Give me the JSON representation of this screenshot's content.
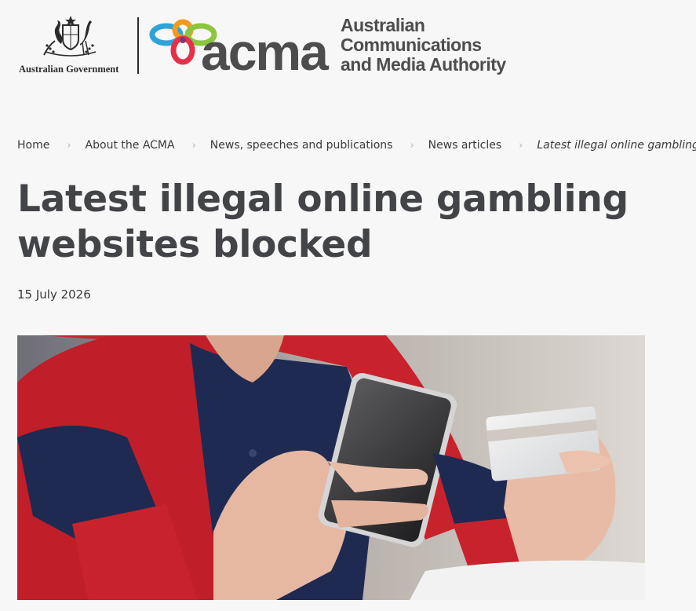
{
  "header": {
    "gov_text": "Australian Government",
    "acma_word": "acma",
    "acma_name": [
      "Australian",
      "Communications",
      "and Media Authority"
    ]
  },
  "breadcrumb": {
    "items": [
      "Home",
      "About the ACMA",
      "News, speeches and publications",
      "News articles",
      "Latest illegal online gambling websites blocked"
    ],
    "separator": "›"
  },
  "article": {
    "title": "Latest illegal online gambling websites blocked",
    "date": "15 July 2026"
  },
  "colors": {
    "background": "#f7f7f7",
    "title": "#424448",
    "logo_grey": "#4d4d4d",
    "ring_blue": "#2ea3d8",
    "ring_orange": "#f39a21",
    "ring_green": "#8cc63f",
    "ring_red": "#e5304a"
  },
  "icons": [
    "coat-of-arms-icon",
    "acma-rings-icon",
    "chevron-right-icon"
  ]
}
